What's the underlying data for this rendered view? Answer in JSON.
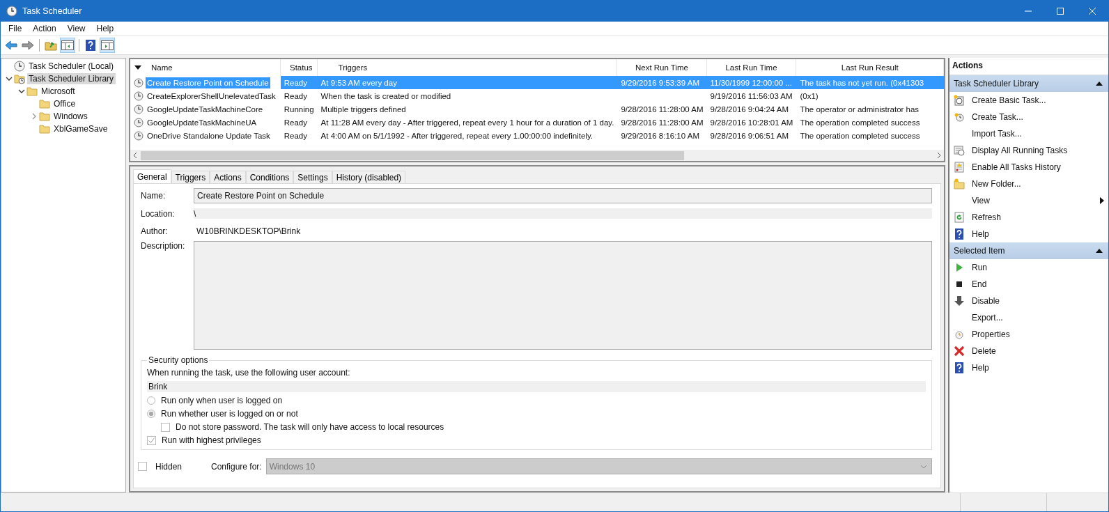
{
  "window": {
    "title": "Task Scheduler"
  },
  "menu": [
    "File",
    "Action",
    "View",
    "Help"
  ],
  "toolbar": [
    {
      "kind": "back",
      "pressed": false
    },
    {
      "kind": "forward",
      "pressed": false
    },
    {
      "kind": "sep"
    },
    {
      "kind": "up",
      "pressed": false
    },
    {
      "kind": "tree-pane",
      "pressed": true
    },
    {
      "kind": "sep"
    },
    {
      "kind": "help",
      "pressed": false
    },
    {
      "kind": "action-pane",
      "pressed": true
    }
  ],
  "tree": [
    {
      "label": "Task Scheduler (Local)",
      "kind": "clock",
      "selected": false,
      "children": [
        {
          "label": "Task Scheduler Library",
          "kind": "clock-folder",
          "selected": true,
          "expanded": true,
          "children": [
            {
              "label": "Microsoft",
              "kind": "folder",
              "selected": false,
              "expanded": true,
              "children": [
                {
                  "label": "Office",
                  "kind": "folder",
                  "selected": false
                },
                {
                  "label": "Windows",
                  "kind": "folder",
                  "selected": false,
                  "expanded": false
                },
                {
                  "label": "XblGameSave",
                  "kind": "folder",
                  "selected": false
                }
              ]
            }
          ]
        }
      ]
    }
  ],
  "table": {
    "columns": [
      "Name",
      "Status",
      "Triggers",
      "Next Run Time",
      "Last Run Time",
      "Last Run Result"
    ],
    "rows": [
      {
        "name": "Create Restore Point on Schedule",
        "status": "Ready",
        "triggers": "At 9:53 AM every day",
        "next_run": "9/29/2016 9:53:39 AM",
        "last_run": "11/30/1999 12:00:00 ...",
        "result": "The task has not yet run. (0x41303",
        "selected": true
      },
      {
        "name": "CreateExplorerShellUnelevatedTask",
        "status": "Ready",
        "triggers": "When the task is created or modified",
        "next_run": "",
        "last_run": "9/19/2016 11:56:03 AM",
        "result": "(0x1)",
        "selected": false
      },
      {
        "name": "GoogleUpdateTaskMachineCore",
        "status": "Running",
        "triggers": "Multiple triggers defined",
        "next_run": "9/28/2016 11:28:00 AM",
        "last_run": "9/28/2016 9:04:24 AM",
        "result": "The operator or administrator has",
        "selected": false
      },
      {
        "name": "GoogleUpdateTaskMachineUA",
        "status": "Ready",
        "triggers": "At 11:28 AM every day - After triggered, repeat every 1 hour for a duration of 1 day.",
        "next_run": "9/28/2016 11:28:00 AM",
        "last_run": "9/28/2016 10:28:01 AM",
        "result": "The operation completed success",
        "selected": false
      },
      {
        "name": "OneDrive Standalone Update Task",
        "status": "Ready",
        "triggers": "At 4:00 AM on 5/1/1992 - After triggered, repeat every 1.00:00:00 indefinitely.",
        "next_run": "9/29/2016 8:16:10 AM",
        "last_run": "9/28/2016 9:06:51 AM",
        "result": "The operation completed success",
        "selected": false
      }
    ]
  },
  "tabs": [
    {
      "label": "General",
      "selected": true
    },
    {
      "label": "Triggers",
      "selected": false
    },
    {
      "label": "Actions",
      "selected": false
    },
    {
      "label": "Conditions",
      "selected": false
    },
    {
      "label": "Settings",
      "selected": false
    },
    {
      "label": "History (disabled)",
      "selected": false
    }
  ],
  "general": {
    "name_label": "Name:",
    "name": "Create Restore Point on Schedule",
    "location_label": "Location:",
    "location": "\\",
    "author_label": "Author:",
    "author": "W10BRINKDESKTOP\\Brink",
    "description_label": "Description:",
    "security": {
      "title": "Security options",
      "account_label": "When running the task, use the following user account:",
      "account": "Brink",
      "radios": [
        {
          "label": "Run only when user is logged on",
          "selected": false
        },
        {
          "label": "Run whether user is logged on or not",
          "selected": true
        }
      ],
      "no_password": {
        "label": "Do not store password.  The task will only have access to local resources",
        "checked": false
      },
      "highest": {
        "label": "Run with highest privileges",
        "checked": true
      }
    },
    "hidden": {
      "label": "Hidden",
      "checked": false
    },
    "configure_label": "Configure for:",
    "configure": "Windows 10"
  },
  "actions": {
    "title": "Actions",
    "sections": [
      {
        "title": "Task Scheduler Library",
        "items": [
          {
            "label": "Create Basic Task...",
            "kind": "basic-task"
          },
          {
            "label": "Create Task...",
            "kind": "task"
          },
          {
            "label": "Import Task...",
            "kind": "none"
          },
          {
            "label": "Display All Running Tasks",
            "kind": "running"
          },
          {
            "label": "Enable All Tasks History",
            "kind": "history"
          },
          {
            "label": "New Folder...",
            "kind": "folder"
          },
          {
            "label": "View",
            "kind": "submenu"
          },
          {
            "label": "Refresh",
            "kind": "refresh"
          },
          {
            "label": "Help",
            "kind": "help"
          }
        ]
      },
      {
        "title": "Selected Item",
        "items": [
          {
            "label": "Run",
            "kind": "run"
          },
          {
            "label": "End",
            "kind": "end"
          },
          {
            "label": "Disable",
            "kind": "disable"
          },
          {
            "label": "Export...",
            "kind": "none"
          },
          {
            "label": "Properties",
            "kind": "properties"
          },
          {
            "label": "Delete",
            "kind": "delete"
          },
          {
            "label": "Help",
            "kind": "help"
          }
        ]
      }
    ]
  }
}
